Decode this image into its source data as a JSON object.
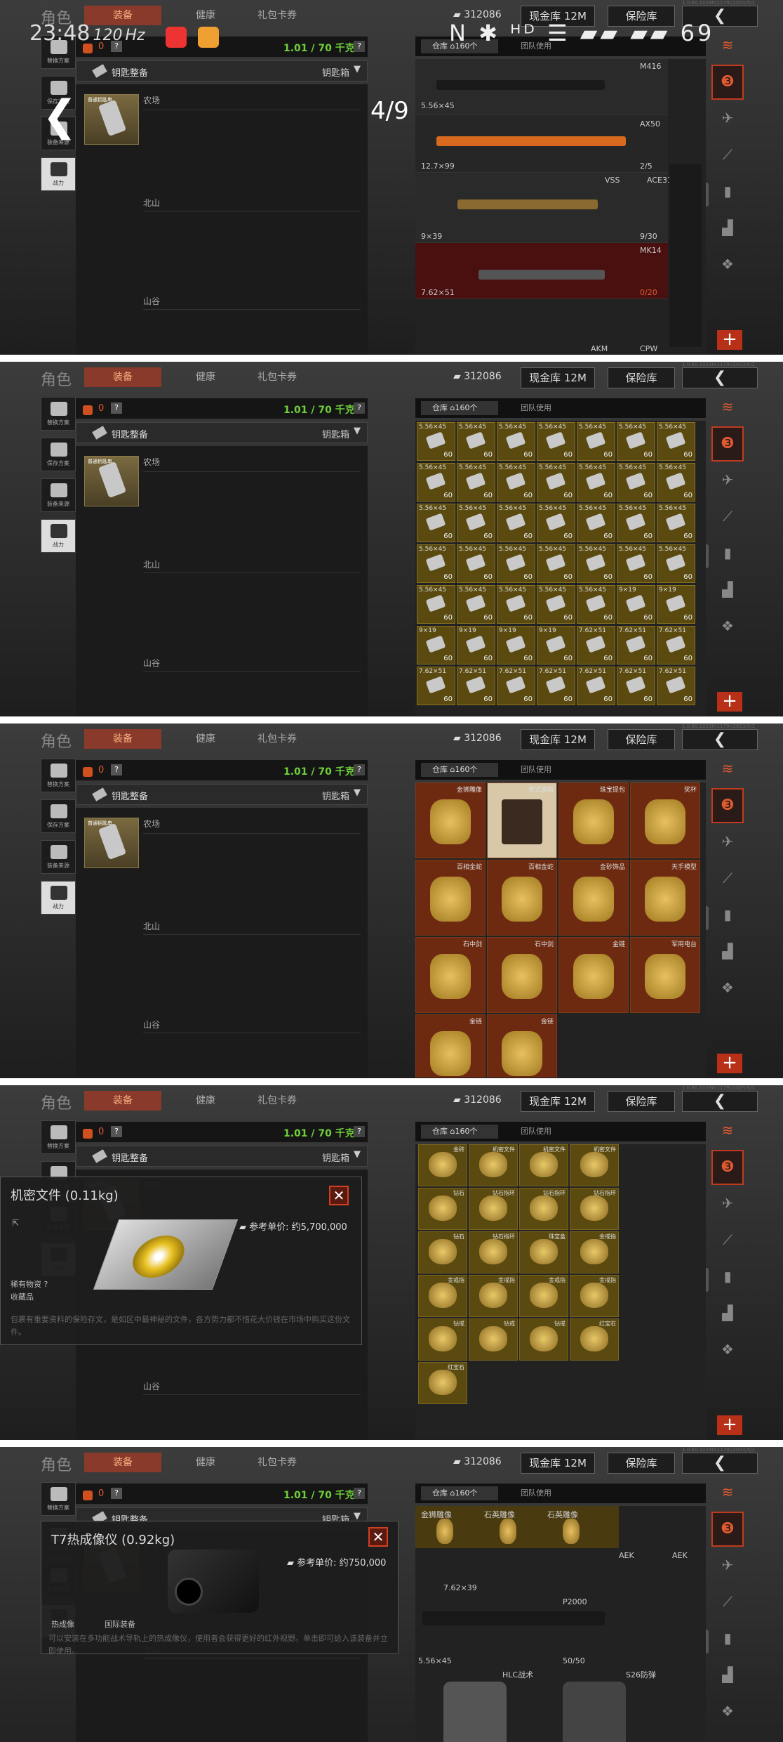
{
  "status": {
    "time": "23:48",
    "hz": "120",
    "hz_unit": "Hz",
    "sys_icons": "N ✱ ᵸᴰ ☰ ▰▰ ▰▰ 69"
  },
  "viewer": {
    "page": "4/9"
  },
  "game": {
    "role": "角色",
    "tab_gear": "装备",
    "tab_health": "健康",
    "tab_gift": "礼包卡券",
    "coins": "312086",
    "cash_btn": "现金库 12M",
    "safe_btn": "保险库",
    "back": "❮",
    "version": "1.0.60.10290(1179)/2023/5/1",
    "left_icons": [
      "替换方案",
      "保存方案",
      "装备来源",
      "战力"
    ],
    "vest_count": "0",
    "weight": "1.01 / 70 千克",
    "keybar_label": "钥匙整备",
    "keybar_right": "钥匙箱",
    "keycard_name": "普通钥匙串",
    "rows": [
      "农场",
      "北山",
      "山谷"
    ],
    "tab_storage": "仓库",
    "tab_storage_count": "160个",
    "tab_team": "团队使用"
  },
  "shot1": {
    "weapons": [
      {
        "name": "M416",
        "cal": "5.56×45"
      },
      {
        "name": "AX50",
        "cal": "12.7×99",
        "count": "2/5"
      },
      {
        "name": "VSS",
        "cal": "9×39",
        "count": "9/30"
      },
      {
        "name": "ACE31",
        "cal": ""
      },
      {
        "name": "MK14",
        "cal": "7.62×51",
        "count": "0/20"
      },
      {
        "name": "AKM",
        "cal": ""
      },
      {
        "name": "CPW",
        "cal": ""
      }
    ]
  },
  "shot2": {
    "ammo": [
      [
        "5.56×45",
        "5.56×45",
        "5.56×45",
        "5.56×45",
        "5.56×45",
        "5.56×45",
        "5.56×45"
      ],
      [
        "5.56×45",
        "5.56×45",
        "5.56×45",
        "5.56×45",
        "5.56×45",
        "5.56×45",
        "5.56×45"
      ],
      [
        "5.56×45",
        "5.56×45",
        "5.56×45",
        "5.56×45",
        "5.56×45",
        "5.56×45",
        "5.56×45"
      ],
      [
        "5.56×45",
        "5.56×45",
        "5.56×45",
        "5.56×45",
        "5.56×45",
        "5.56×45",
        "5.56×45"
      ],
      [
        "5.56×45",
        "5.56×45",
        "5.56×45",
        "5.56×45",
        "5.56×45",
        "9×19",
        "9×19"
      ],
      [
        "9×19",
        "9×19",
        "9×19",
        "9×19",
        "7.62×51",
        "7.62×51",
        "7.62×51"
      ],
      [
        "7.62×51",
        "7.62×51",
        "7.62×51",
        "7.62×51",
        "7.62×51",
        "7.62×51",
        "7.62×51"
      ]
    ],
    "count": "60"
  },
  "shot3": {
    "valuables": [
      "金狮雕像",
      "老式音箱",
      "珠宝提包",
      "奖杯",
      "百相金蛇",
      "百相金蛇",
      "金砂饰品",
      "天手模型",
      "石中剑",
      "石中剑",
      "金链",
      "军用电台",
      "金链",
      "金链"
    ]
  },
  "shot4": {
    "popup": {
      "title": "机密文件 (0.11kg)",
      "price_label": "参考单价: 约5,700,000",
      "tag1": "稀有物资 ?",
      "tag2": "收藏品",
      "desc": "包裹有重要资料的保险存文，是如区中最神秘的文件，各方势力都不惜花大价钱在市场中购买这份文件。"
    },
    "valuables": [
      "金砖",
      "机密文件",
      "机密文件",
      "机密文件",
      "钻石",
      "钻石指环",
      "钻石指环",
      "钻石指环",
      "钻石",
      "钻石指环",
      "珠宝盒",
      "金戒指",
      "金戒指",
      "金戒指",
      "金戒指",
      "金戒指",
      "钻戒",
      "钻戒",
      "钻戒",
      "红宝石",
      "红宝石"
    ]
  },
  "shot5": {
    "popup": {
      "title": "T7热成像仪 (0.92kg)",
      "price_label": "参考单价: 约750,000",
      "tag1": "热成像",
      "tag2": "国际装备",
      "desc": "可以安装在多功能战术导轨上的热成像仪，使用者会获得更好的红外视野。单击即可给入该装备并立即使用。"
    },
    "items": [
      "金狮雕像",
      "石英雕像",
      "石英雕像",
      "AEK",
      "AEK",
      "7.62×39",
      "P2000",
      "5.56×45",
      "50/50",
      "HLC战术",
      "S26防弹",
      "T7热成像"
    ]
  }
}
